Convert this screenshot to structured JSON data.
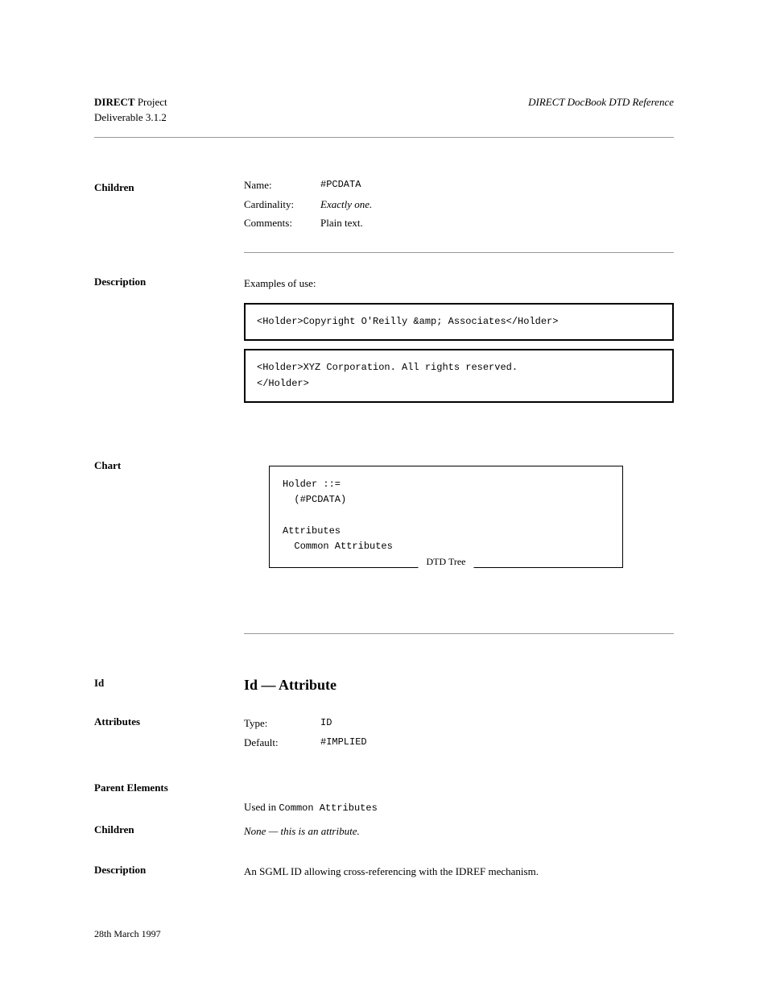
{
  "header": {
    "line1_bold": "DIRECT",
    "line1_rest": " Project",
    "line2": "Deliverable 3.1.2",
    "right": "DIRECT DocBook DTD Reference"
  },
  "children": {
    "label": "Children",
    "rows": [
      {
        "label": "Name:",
        "value": "#PCDATA",
        "mono": true
      },
      {
        "label": "Cardinality:",
        "value": "Exactly one.",
        "italic": true
      },
      {
        "label": "Comments:",
        "value": "Plain text."
      }
    ]
  },
  "description": {
    "label": "Description",
    "intro": "Examples of use:",
    "code1": "<Holder>Copyright O'Reilly &amp; Associates</Holder>",
    "code2": "<Holder>XYZ Corporation. All rights reserved.\n</Holder>"
  },
  "chart": {
    "label": "Chart",
    "dtd_lines": [
      "Holder ::=",
      "  (#PCDATA)",
      "",
      "Attributes",
      "  Common Attributes"
    ],
    "caption": "DTD Tree"
  },
  "id_section": {
    "left_label": "Id",
    "title": "Id — Attribute",
    "attributes": {
      "label": "Attributes",
      "rows": [
        {
          "label": "Type:",
          "value": "ID",
          "mono": true
        },
        {
          "label": "Default:",
          "value": "#IMPLIED",
          "mono": true
        }
      ]
    },
    "parent": {
      "label": "Parent Elements",
      "line1": "",
      "line2": "Used in Common Attributes",
      "line2_mono_part": "Common Attributes"
    },
    "children": {
      "label": "Children",
      "value": "None — this is an attribute.",
      "italic": true
    },
    "description": {
      "label": "Description",
      "body": "An SGML ID allowing cross-referencing with the IDREF mechanism."
    }
  },
  "footer": "28th March 1997"
}
